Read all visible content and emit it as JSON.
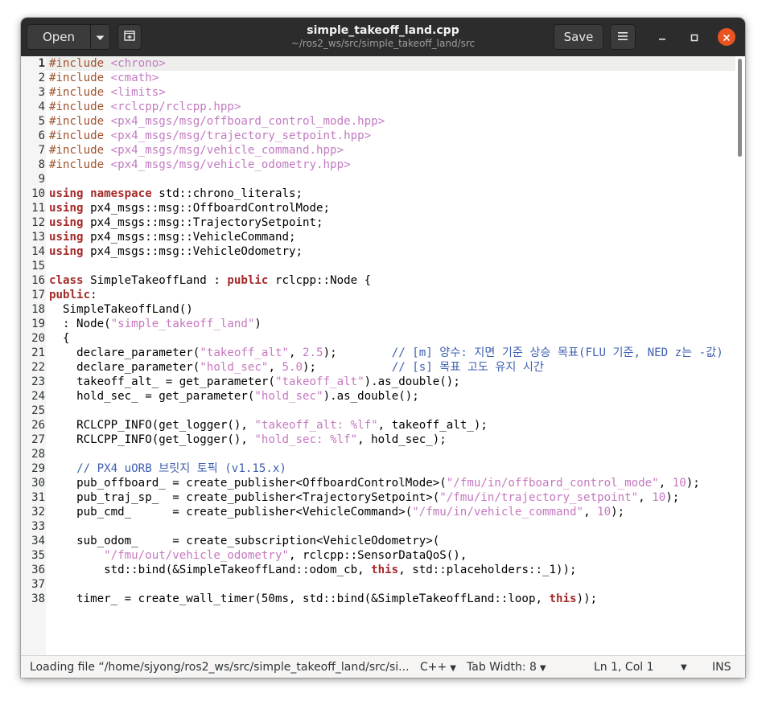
{
  "window": {
    "title": "simple_takeoff_land.cpp",
    "subtitle": "~/ros2_ws/src/simple_takeoff_land/src"
  },
  "header": {
    "open_label": "Open",
    "save_label": "Save"
  },
  "colors": {
    "headerbar": "#2c2c2c",
    "close_button": "#e95420",
    "keyword": "#a52a2a",
    "string": "#c678c0",
    "preprocessor": "#a0522d",
    "comment": "#3e5fb0"
  },
  "editor": {
    "current_line": 1,
    "lines": [
      {
        "n": "1",
        "tokens": [
          [
            "pp",
            "#include "
          ],
          [
            "inc",
            "<chrono>"
          ]
        ]
      },
      {
        "n": "2",
        "tokens": [
          [
            "pp",
            "#include "
          ],
          [
            "inc",
            "<cmath>"
          ]
        ]
      },
      {
        "n": "3",
        "tokens": [
          [
            "pp",
            "#include "
          ],
          [
            "inc",
            "<limits>"
          ]
        ]
      },
      {
        "n": "4",
        "tokens": [
          [
            "pp",
            "#include "
          ],
          [
            "inc",
            "<rclcpp/rclcpp.hpp>"
          ]
        ]
      },
      {
        "n": "5",
        "tokens": [
          [
            "pp",
            "#include "
          ],
          [
            "inc",
            "<px4_msgs/msg/offboard_control_mode.hpp>"
          ]
        ]
      },
      {
        "n": "6",
        "tokens": [
          [
            "pp",
            "#include "
          ],
          [
            "inc",
            "<px4_msgs/msg/trajectory_setpoint.hpp>"
          ]
        ]
      },
      {
        "n": "7",
        "tokens": [
          [
            "pp",
            "#include "
          ],
          [
            "inc",
            "<px4_msgs/msg/vehicle_command.hpp>"
          ]
        ]
      },
      {
        "n": "8",
        "tokens": [
          [
            "pp",
            "#include "
          ],
          [
            "inc",
            "<px4_msgs/msg/vehicle_odometry.hpp>"
          ]
        ]
      },
      {
        "n": "9",
        "tokens": []
      },
      {
        "n": "10",
        "tokens": [
          [
            "kw",
            "using"
          ],
          [
            "nm",
            " "
          ],
          [
            "kw",
            "namespace"
          ],
          [
            "nm",
            " std::chrono_literals;"
          ]
        ]
      },
      {
        "n": "11",
        "tokens": [
          [
            "kw",
            "using"
          ],
          [
            "nm",
            " px4_msgs::msg::OffboardControlMode;"
          ]
        ]
      },
      {
        "n": "12",
        "tokens": [
          [
            "kw",
            "using"
          ],
          [
            "nm",
            " px4_msgs::msg::TrajectorySetpoint;"
          ]
        ]
      },
      {
        "n": "13",
        "tokens": [
          [
            "kw",
            "using"
          ],
          [
            "nm",
            " px4_msgs::msg::VehicleCommand;"
          ]
        ]
      },
      {
        "n": "14",
        "tokens": [
          [
            "kw",
            "using"
          ],
          [
            "nm",
            " px4_msgs::msg::VehicleOdometry;"
          ]
        ]
      },
      {
        "n": "15",
        "tokens": []
      },
      {
        "n": "16",
        "tokens": [
          [
            "kw",
            "class"
          ],
          [
            "nm",
            " SimpleTakeoffLand : "
          ],
          [
            "kw",
            "public"
          ],
          [
            "nm",
            " rclcpp::Node {"
          ]
        ]
      },
      {
        "n": "17",
        "tokens": [
          [
            "kw",
            "public"
          ],
          [
            "nm",
            ":"
          ]
        ]
      },
      {
        "n": "18",
        "tokens": [
          [
            "nm",
            "  SimpleTakeoffLand()"
          ]
        ]
      },
      {
        "n": "19",
        "tokens": [
          [
            "nm",
            "  : Node("
          ],
          [
            "str",
            "\"simple_takeoff_land\""
          ],
          [
            "nm",
            ")"
          ]
        ]
      },
      {
        "n": "20",
        "tokens": [
          [
            "nm",
            "  {"
          ]
        ]
      },
      {
        "n": "21",
        "tokens": [
          [
            "nm",
            "    declare_parameter("
          ],
          [
            "str",
            "\"takeoff_alt\""
          ],
          [
            "nm",
            ", "
          ],
          [
            "num",
            "2.5"
          ],
          [
            "nm",
            ");        "
          ],
          [
            "cm",
            "// [m] 양수: 지면 기준 상승 목표(FLU 기준, NED z는 -값)"
          ]
        ]
      },
      {
        "n": "22",
        "tokens": [
          [
            "nm",
            "    declare_parameter("
          ],
          [
            "str",
            "\"hold_sec\""
          ],
          [
            "nm",
            ", "
          ],
          [
            "num",
            "5.0"
          ],
          [
            "nm",
            ");           "
          ],
          [
            "cm",
            "// [s] 목표 고도 유지 시간"
          ]
        ]
      },
      {
        "n": "23",
        "tokens": [
          [
            "nm",
            "    takeoff_alt_ = get_parameter("
          ],
          [
            "str",
            "\"takeoff_alt\""
          ],
          [
            "nm",
            ").as_double();"
          ]
        ]
      },
      {
        "n": "24",
        "tokens": [
          [
            "nm",
            "    hold_sec_ = get_parameter("
          ],
          [
            "str",
            "\"hold_sec\""
          ],
          [
            "nm",
            ").as_double();"
          ]
        ]
      },
      {
        "n": "25",
        "tokens": []
      },
      {
        "n": "26",
        "tokens": [
          [
            "nm",
            "    RCLCPP_INFO(get_logger(), "
          ],
          [
            "str",
            "\"takeoff_alt: %lf\""
          ],
          [
            "nm",
            ", takeoff_alt_);"
          ]
        ]
      },
      {
        "n": "27",
        "tokens": [
          [
            "nm",
            "    RCLCPP_INFO(get_logger(), "
          ],
          [
            "str",
            "\"hold_sec: %lf\""
          ],
          [
            "nm",
            ", hold_sec_);"
          ]
        ]
      },
      {
        "n": "28",
        "tokens": []
      },
      {
        "n": "29",
        "tokens": [
          [
            "cm",
            "    // PX4 uORB 브릿지 토픽 (v1.15.x)"
          ]
        ]
      },
      {
        "n": "30",
        "tokens": [
          [
            "nm",
            "    pub_offboard_ = create_publisher<OffboardControlMode>("
          ],
          [
            "str",
            "\"/fmu/in/offboard_control_mode\""
          ],
          [
            "nm",
            ", "
          ],
          [
            "num",
            "10"
          ],
          [
            "nm",
            ");"
          ]
        ]
      },
      {
        "n": "31",
        "tokens": [
          [
            "nm",
            "    pub_traj_sp_  = create_publisher<TrajectorySetpoint>("
          ],
          [
            "str",
            "\"/fmu/in/trajectory_setpoint\""
          ],
          [
            "nm",
            ", "
          ],
          [
            "num",
            "10"
          ],
          [
            "nm",
            ");"
          ]
        ]
      },
      {
        "n": "32",
        "tokens": [
          [
            "nm",
            "    pub_cmd_      = create_publisher<VehicleCommand>("
          ],
          [
            "str",
            "\"/fmu/in/vehicle_command\""
          ],
          [
            "nm",
            ", "
          ],
          [
            "num",
            "10"
          ],
          [
            "nm",
            ");"
          ]
        ]
      },
      {
        "n": "33",
        "tokens": []
      },
      {
        "n": "34",
        "tokens": [
          [
            "nm",
            "    sub_odom_     = create_subscription<VehicleOdometry>("
          ]
        ]
      },
      {
        "n": "35",
        "tokens": [
          [
            "nm",
            "        "
          ],
          [
            "str",
            "\"/fmu/out/vehicle_odometry\""
          ],
          [
            "nm",
            ", rclcpp::SensorDataQoS(),"
          ]
        ]
      },
      {
        "n": "36",
        "tokens": [
          [
            "nm",
            "        std::bind(&SimpleTakeoffLand::odom_cb, "
          ],
          [
            "kw",
            "this"
          ],
          [
            "nm",
            ", std::placeholders::_1));"
          ]
        ]
      },
      {
        "n": "37",
        "tokens": []
      },
      {
        "n": "38",
        "tokens": [
          [
            "nm",
            "    timer_ = create_wall_timer(50ms, std::bind(&SimpleTakeoffLand::loop, "
          ],
          [
            "kw",
            "this"
          ],
          [
            "nm",
            "));"
          ]
        ]
      }
    ]
  },
  "statusbar": {
    "file_status": "Loading file “/home/sjyong/ros2_ws/src/simple_takeoff_land/src/si...",
    "language": "C++",
    "tab_width": "Tab Width: 8",
    "position": "Ln 1, Col 1",
    "mode": "INS"
  },
  "icons": {
    "open_menu": "chevron-down-icon",
    "new_tab": "new-tab-icon",
    "menu": "hamburger-menu-icon",
    "minimize": "minimize-icon",
    "maximize": "maximize-icon",
    "close": "close-icon"
  }
}
